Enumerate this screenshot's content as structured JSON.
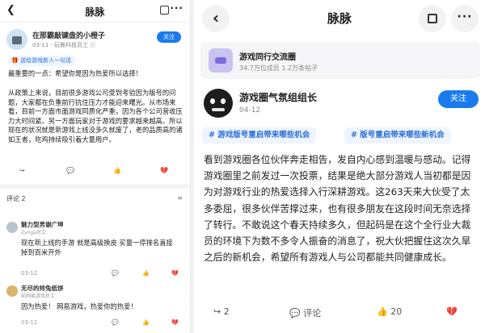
{
  "left": {
    "nav": {
      "back": "❮",
      "title": "脉脉",
      "more": "···"
    },
    "author": {
      "name": "在那霸敲键盘的小橙子",
      "meta": "03-11 · 玩餐科技员工 ⓥ",
      "follow": "关注"
    },
    "gift": "🎁 送给游戏新人一句话",
    "first_line": "最重要的一点：希望你是因为热爱所以选择！",
    "body": "从政策上来说，目前很多游戏公司受到考验因为版号的问题，大家都在负重前行抗住压力才能迎来曙光。从市场来看，目前一方面市面游戏同质化严重，因为各个公司营收压力大时间紧。另一方面玩家对于游戏的要求越来越高。所以现在的状况就是新游戏上线没多久就废了，老的品质高的诸如王者，吃鸡持续吸引着大量用户。",
    "actions": {
      "share": "↪",
      "comment": "💬",
      "like": "👍",
      "dislike": "💔"
    },
    "comments_head": {
      "label": "评论 2",
      "sort": "≡"
    },
    "comments": [
      {
        "name": "魅力型男谢广坤",
        "meta": "Zynga员工",
        "text": "现在新上线的手游 就是高级换皮 买量一停排名直接掉到百米开外",
        "time": "03-12",
        "reply": "💬",
        "like": "👍",
        "dislike": "💔"
      },
      {
        "name": "无尽的帅兔纸饼",
        "meta": "前网易游戏员工",
        "text": "因为热爱！ 网易游戏，热爱你的热爱！",
        "time": "03-12",
        "reply": "💬",
        "like": "👍",
        "dislike": "💔"
      }
    ]
  },
  "right": {
    "nav": {
      "back": "‹",
      "title": "脉脉",
      "more": "···"
    },
    "circle": {
      "name": "游戏同行交流圈",
      "stats": "34.7万位成员 1.2万条帖子"
    },
    "author": {
      "name": "游戏圈气氛组组长",
      "date": "04-12",
      "follow": "关注"
    },
    "tags": [
      "# 游戏版号重启带来哪些机会",
      "# 版号重启带来哪些新机会"
    ],
    "body": "看到游戏圈各位伙伴奔走相告，发自内心感到温暖与感动。记得游戏圈里之前发过一次投票，结果是绝大部分游戏人当初都是因为对游戏行业的热爱选择入行深耕游戏。这263天来大伙受了太多委屈，很多伙伴苦撑过来，也有很多朋友在这段时间无奈选择了转行。不敢说这个春天持续多久，但起码是在这个全行业大裁员的环境下为数不多令人振奋的消息了，祝大伙把握住这次久旱之后的新机会，希望所有游戏人与公司都能共同健康成长。",
    "actions": {
      "share_count": "↪ 2",
      "comment": "💬 评论",
      "like_count": "👍 20",
      "dislike": "💔"
    }
  }
}
